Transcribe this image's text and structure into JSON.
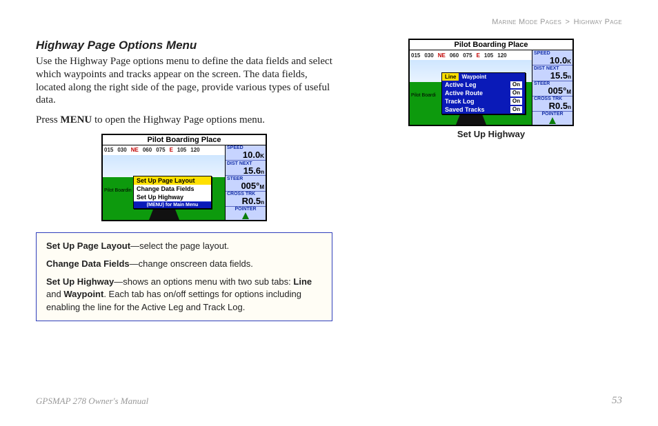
{
  "breadcrumb": {
    "section": "Marine Mode Pages",
    "sep": ">",
    "page": "Highway Page"
  },
  "left": {
    "title": "Highway Page Options Menu",
    "para1": "Use the Highway Page options menu to define the data fields and select which waypoints and tracks appear on the screen. The data fields, located along the right side of the page, provide various types of useful data.",
    "para2_pre": "Press ",
    "para2_strong": "MENU",
    "para2_post": " to open the Highway Page options menu."
  },
  "fig1": {
    "title": "Pilot Boarding Place",
    "compass": [
      "015",
      "030",
      "NE",
      "060",
      "075",
      "E",
      "105",
      "120"
    ],
    "side_label": "Pilot Boardin",
    "menu": {
      "items": [
        "Set Up Page Layout",
        "Change Data Fields",
        "Set Up Highway"
      ],
      "selected_index": 0,
      "footer": "(MENU) for Main Menu"
    },
    "metrics": {
      "speed": {
        "label": "SPEED",
        "value": "10.0",
        "unit": "K"
      },
      "dist_next": {
        "label": "DIST NEXT",
        "value": "15.6",
        "unit": "n"
      },
      "steer": {
        "label": "STEER",
        "value": "005°",
        "unit": "M"
      },
      "cross_trk": {
        "label": "CROSS TRK",
        "value": "R0.5",
        "unit": "n"
      },
      "pointer": {
        "label": "POINTER"
      }
    }
  },
  "fig2": {
    "title": "Pilot Boarding Place",
    "compass": [
      "015",
      "030",
      "NE",
      "060",
      "075",
      "E",
      "105",
      "120"
    ],
    "side_label": "Pilot Boardi",
    "setup": {
      "tabs": [
        "Line",
        "Waypoint"
      ],
      "selected_tab": 0,
      "rows": [
        {
          "name": "Active Leg",
          "state": "On"
        },
        {
          "name": "Active Route",
          "state": "On"
        },
        {
          "name": "Track Log",
          "state": "On"
        },
        {
          "name": "Saved Tracks",
          "state": "On"
        }
      ]
    },
    "metrics": {
      "speed": {
        "label": "SPEED",
        "value": "10.0",
        "unit": "K"
      },
      "dist_next": {
        "label": "DIST NEXT",
        "value": "15.5",
        "unit": "n"
      },
      "steer": {
        "label": "STEER",
        "value": "005°",
        "unit": "M"
      },
      "cross_trk": {
        "label": "CROSS TRK",
        "value": "R0.5",
        "unit": "n"
      },
      "pointer": {
        "label": "POINTER"
      }
    },
    "caption": "Set Up Highway"
  },
  "notebox": {
    "p1_strong": "Set Up Page Layout",
    "p1_rest": "—select the page layout.",
    "p2_strong": "Change Data Fields",
    "p2_rest": "—change onscreen data fields.",
    "p3_strong1": "Set Up Highway",
    "p3_mid1": "—shows an options menu with two sub tabs: ",
    "p3_strong2": "Line",
    "p3_mid2": " and ",
    "p3_strong3": "Waypoint",
    "p3_rest": ". Each tab has on/off settings for options including enabling the line for the Active Leg and Track Log."
  },
  "footer": {
    "manual": "GPSMAP 278 Owner's Manual",
    "page_number": "53"
  }
}
